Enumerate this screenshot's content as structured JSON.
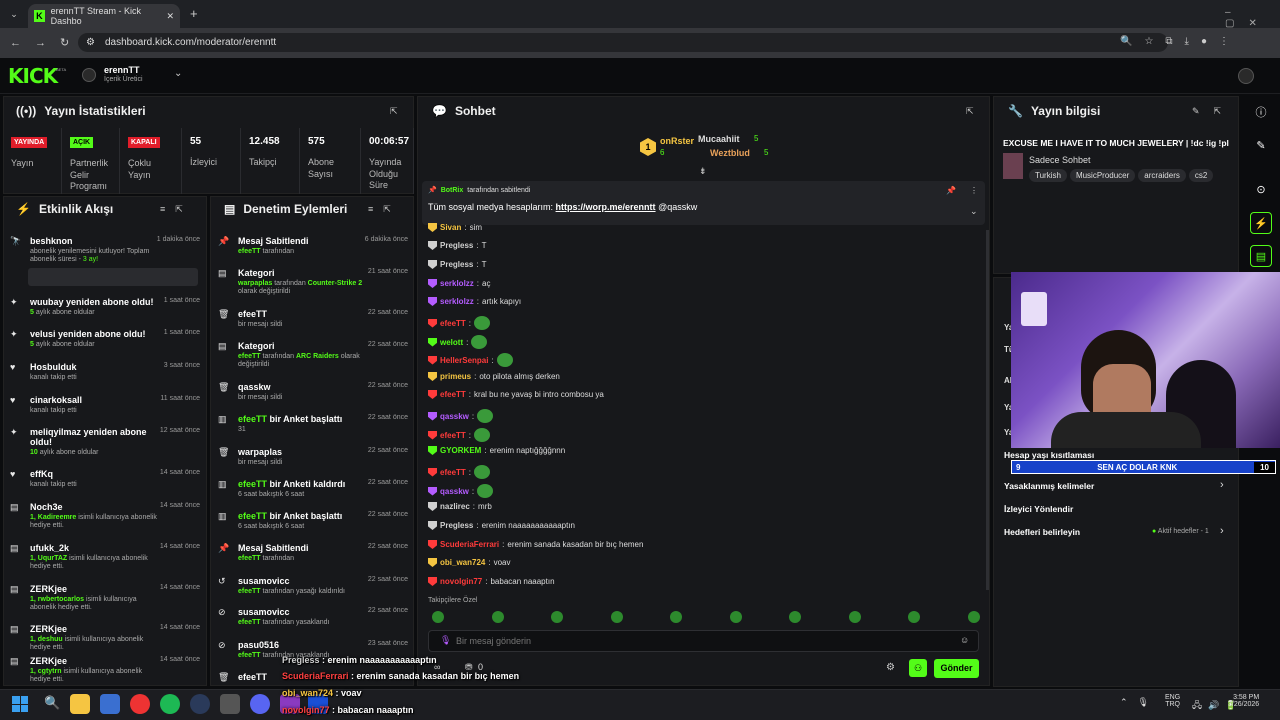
{
  "browser": {
    "tab_title": "erennTT Stream - Kick Dashbo",
    "url": "dashboard.kick.com/moderator/erenntt"
  },
  "header": {
    "logo": "KICK",
    "logo_beta": "BETA",
    "channel": "erennTT",
    "role": "İçerik Üretici"
  },
  "stats": {
    "title": "Yayın İstatistikleri",
    "items": [
      {
        "badge": "YAYINDA",
        "badge_color": "#e11d2a",
        "label": "Yayın"
      },
      {
        "badge": "AÇIK",
        "badge_color": "#53fc18",
        "label": "Partnerlik Gelir Programı"
      },
      {
        "badge": "KAPALI",
        "badge_color": "#e11d2a",
        "label": "Çoklu Yayın"
      },
      {
        "value": "55",
        "label": "İzleyici"
      },
      {
        "value": "12.458",
        "label": "Takipçi"
      },
      {
        "value": "575",
        "label": "Abone Sayısı"
      },
      {
        "value": "00:06:57",
        "label": "Yayında Olduğu Süre"
      }
    ]
  },
  "activity": {
    "title": "Etkinlik Akışı",
    "items": [
      {
        "name": "beshknon",
        "time": "1 dakika önce",
        "sub": "abonelik yenilemesini kutluyor! Toplam abonelik süresi - ",
        "sub_hl": "3 ay!"
      },
      {
        "name": "wuubay yeniden abone oldu!",
        "time": "1 saat önce",
        "hl": "5",
        "sub": " aylık abone oldular"
      },
      {
        "name": "velusi yeniden abone oldu!",
        "time": "1 saat önce",
        "hl": "5",
        "sub": " aylık abone oldular"
      },
      {
        "name": "Hosbulduk",
        "time": "3 saat önce",
        "sub": "kanalı takip etti"
      },
      {
        "name": "cinarkoksall",
        "time": "11 saat önce",
        "sub": "kanalı takip etti"
      },
      {
        "name": "meliqyilmaz yeniden abone oldu!",
        "time": "12 saat önce",
        "hl": "10",
        "sub": " aylık abone oldular"
      },
      {
        "name": "effKq",
        "time": "14 saat önce",
        "sub": "kanalı takip etti"
      },
      {
        "name": "Noch3e",
        "time": "14 saat önce",
        "hl": "1, Kadireemre",
        "sub": " isimli kullanıcıya abonelik hediye etti."
      },
      {
        "name": "ufukk_2k",
        "time": "14 saat önce",
        "hl": "1, UqurTAZ",
        "sub": " isimli kullanıcıya abonelik hediye etti."
      },
      {
        "name": "ZERKjee",
        "time": "14 saat önce",
        "hl": "1, rwbertocarlos",
        "sub": " isimli kullanıcıya abonelik hediye etti."
      },
      {
        "name": "ZERKjee",
        "time": "14 saat önce",
        "hl": "1, deshuu",
        "sub": " isimli kullanıcıya abonelik hediye etti."
      },
      {
        "name": "ZERKjee",
        "time": "14 saat önce",
        "hl": "1, cgtytrn",
        "sub": " isimli kullanıcıya abonelik hediye etti."
      }
    ]
  },
  "moderation": {
    "title": "Denetim Eylemleri",
    "items": [
      {
        "name": "Mesaj Sabitlendi",
        "time": "6 dakika önce",
        "hl": "efeeTT",
        "sub": " tarafından"
      },
      {
        "name": "Kategori",
        "time": "21 saat önce",
        "hl": "warpaplas",
        "sub": " tarafından Counter-Strike 2 olarak değiştirildi"
      },
      {
        "name": "efeeTT",
        "time": "22 saat önce",
        "sub": "bir mesajı sildi"
      },
      {
        "name": "Kategori",
        "time": "22 saat önce",
        "hl": "efeeTT",
        "sub": " tarafından ARC Raiders olarak değiştirildi"
      },
      {
        "name": "qasskw",
        "time": "22 saat önce",
        "sub": "bir mesajı sildi"
      },
      {
        "name": "efeeTT bir Anket başlattı",
        "time": "22 saat önce",
        "sub": "31"
      },
      {
        "name": "warpaplas",
        "time": "22 saat önce",
        "sub": "bir mesajı sildi"
      },
      {
        "name": "efeeTT bir Anketi kaldırdı",
        "time": "22 saat önce",
        "sub": "6 saat bakıştık 6 saat"
      },
      {
        "name": "efeeTT bir Anket başlattı",
        "time": "22 saat önce",
        "sub": "6 saat bakıştık 6 saat"
      },
      {
        "name": "Mesaj Sabitlendi",
        "time": "22 saat önce",
        "hl": "efeeTT",
        "sub": " tarafından"
      },
      {
        "name": "susamovicc",
        "time": "22 saat önce",
        "hl": "efeeTT",
        "sub": " tarafından yasağı kaldırıldı"
      },
      {
        "name": "susamovicc",
        "time": "22 saat önce",
        "hl": "efeeTT",
        "sub": " tarafından yasaklandı"
      },
      {
        "name": "pasu0516",
        "time": "23 saat önce",
        "hl": "efeeTT",
        "sub": " tarafından yasaklandı"
      },
      {
        "name": "efeeTT",
        "time": "",
        "sub": ""
      }
    ]
  },
  "chat": {
    "title": "Sohbet",
    "leaders": [
      {
        "name": "onRster",
        "rank": "1",
        "count": "6"
      },
      {
        "name": "Mucaahiit",
        "count": "5"
      },
      {
        "name": "Weztblud",
        "count": "5"
      }
    ],
    "pinned_by": "BotRix",
    "pinned_suffix": "tarafından sabitlendi",
    "pinned_text": "Tüm sosyal medya hesaplarım: ",
    "pinned_link": "https://worp.me/erenntt",
    "pinned_tail": " @qasskw",
    "messages": [
      {
        "user": "Sivan",
        "color": "#f5c542",
        "text": "sim"
      },
      {
        "user": "Pregless",
        "color": "#d0d0d0",
        "text": "T"
      },
      {
        "user": "Pregless",
        "color": "#d0d0d0",
        "text": "T"
      },
      {
        "user": "serklolzz",
        "color": "#b45cff",
        "text": "aç"
      },
      {
        "user": "serklolzz",
        "color": "#b45cff",
        "text": "artık kapıyı"
      },
      {
        "user": "efeeTT",
        "color": "#ff3b3b",
        "text": ""
      },
      {
        "user": "welott",
        "color": "#53fc18",
        "text": ""
      },
      {
        "user": "HellerSenpai",
        "color": "#ff3b3b",
        "text": ""
      },
      {
        "user": "primeus",
        "color": "#f5c542",
        "text": "oto pilota almış derken"
      },
      {
        "user": "efeeTT",
        "color": "#ff3b3b",
        "text": "kral bu ne yavaş bi intro combosu ya"
      },
      {
        "user": "qasskw",
        "color": "#b45cff",
        "text": ""
      },
      {
        "user": "efeeTT",
        "color": "#ff3b3b",
        "text": ""
      },
      {
        "user": "GYORKEM",
        "color": "#53fc18",
        "text": "erenim naptığğğğnnn"
      },
      {
        "user": "efeeTT",
        "color": "#ff3b3b",
        "text": ""
      },
      {
        "user": "qasskw",
        "color": "#b45cff",
        "text": ""
      },
      {
        "user": "nazlirec",
        "color": "#d0d0d0",
        "text": "mrb"
      },
      {
        "user": "Pregless",
        "color": "#d0d0d0",
        "text": "erenim naaaaaaaaaaaptın"
      },
      {
        "user": "ScuderiaFerrari",
        "color": "#ff3b3b",
        "text": "erenim sanada kasadan bir bıç hemen"
      },
      {
        "user": "obi_wan724",
        "color": "#f5c542",
        "text": "voav"
      },
      {
        "user": "novolgin77",
        "color": "#ff3b3b",
        "text": "babacan naaaptın"
      }
    ],
    "emote_label": "Takipçilere Özel",
    "input_placeholder": "Bir mesaj gönderin",
    "points": "0",
    "send": "Gönder"
  },
  "info": {
    "title": "Yayın bilgisi",
    "stream_title": "EXCUSE ME I HAVE IT TO MUCH JEWELERY | !dc !ig !pl",
    "sub": "Sadece Sohbet",
    "tags": [
      "Turkish",
      "MusicProducer",
      "arcraiders",
      "cs2"
    ],
    "settings": [
      "Hesap yaşı kısıtlaması",
      "Yasaklanmış kelimeler",
      "İzleyici Yönlendir",
      "Hedefleri belirleyin"
    ],
    "goal_status": "Aktif hedefler - 1",
    "partial": [
      "Ya",
      "Tü",
      "Al",
      "Ya",
      "Ya"
    ]
  },
  "webcam": {
    "bar_left": "9",
    "bar_text": "SEN AÇ DOLAR KNK",
    "bar_right": "10"
  },
  "overlay_chat": [
    {
      "user": "Pregless",
      "color": "#d0d0d0",
      "text": " : erenim naaaaaaaaaaaptın"
    },
    {
      "user": "ScuderiaFerrari",
      "color": "#ff4040",
      "text": " : erenim sanada kasadan bir bıç hemen"
    },
    {
      "user": "obi_wan724",
      "color": "#f5c542",
      "text": " : voav"
    },
    {
      "user": "novolgin77",
      "color": "#ff4040",
      "text": " : babacan naaaptın"
    }
  ],
  "taskbar": {
    "lang1": "ENG",
    "lang2": "TRQ",
    "time": "3:58 PM",
    "date": "3/26/2026"
  }
}
